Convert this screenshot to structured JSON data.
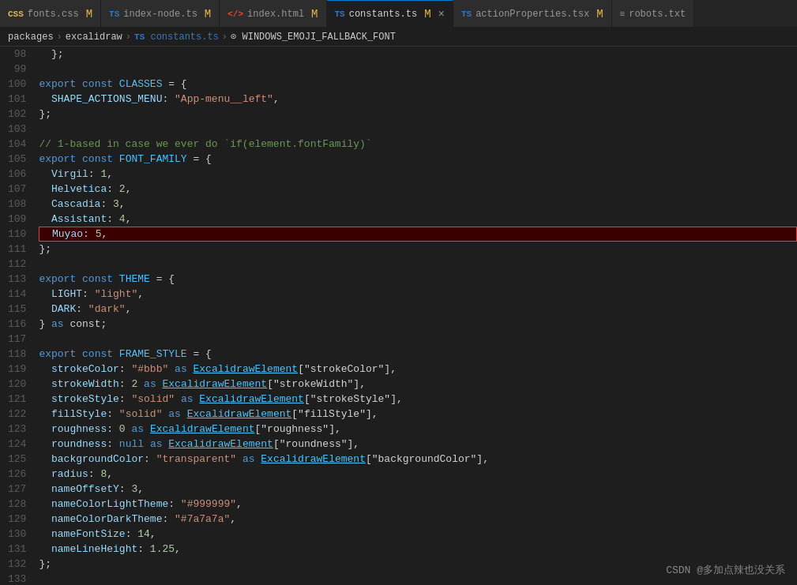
{
  "tabs": [
    {
      "id": "fonts-css",
      "icon": "CSS",
      "label": "fonts.css",
      "modified": true,
      "active": false,
      "lang": "css"
    },
    {
      "id": "index-node-ts",
      "icon": "TS",
      "label": "index-node.ts",
      "modified": true,
      "active": false,
      "lang": "ts"
    },
    {
      "id": "index-html",
      "icon": "HTML",
      "label": "index.html",
      "modified": true,
      "active": false,
      "lang": "html"
    },
    {
      "id": "constants-ts",
      "icon": "TS",
      "label": "constants.ts",
      "modified": true,
      "active": true,
      "lang": "ts"
    },
    {
      "id": "actionProperties-tsx",
      "icon": "TS",
      "label": "actionProperties.tsx",
      "modified": true,
      "active": false,
      "lang": "ts"
    },
    {
      "id": "robots-txt",
      "icon": "TXT",
      "label": "robots.txt",
      "modified": false,
      "active": false,
      "lang": "txt"
    }
  ],
  "breadcrumb": {
    "parts": [
      "packages",
      "excalidraw",
      "TS constants.ts",
      "⊙ WINDOWS_EMOJI_FALLBACK_FONT"
    ]
  },
  "lines": {
    "start": 98,
    "count": 36
  },
  "watermark": "CSDN @多加点辣也没关系"
}
